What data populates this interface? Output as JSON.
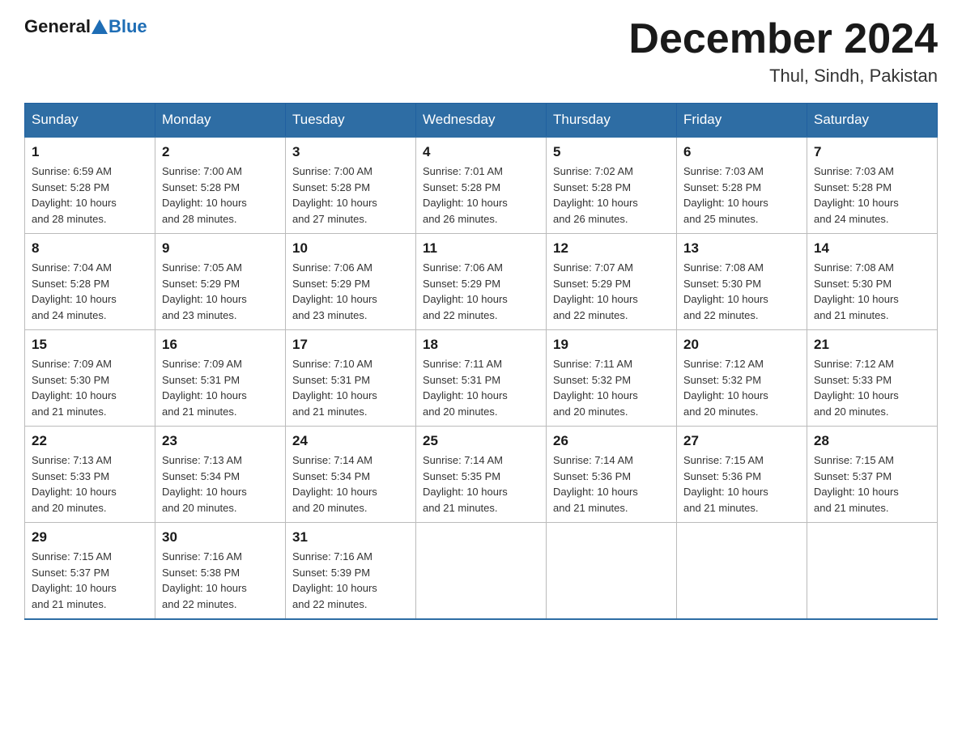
{
  "header": {
    "logo": {
      "general": "General",
      "blue": "Blue"
    },
    "title": "December 2024",
    "location": "Thul, Sindh, Pakistan"
  },
  "calendar": {
    "days_of_week": [
      "Sunday",
      "Monday",
      "Tuesday",
      "Wednesday",
      "Thursday",
      "Friday",
      "Saturday"
    ],
    "weeks": [
      [
        {
          "day": "1",
          "sunrise": "Sunrise: 6:59 AM",
          "sunset": "Sunset: 5:28 PM",
          "daylight": "Daylight: 10 hours",
          "daylight2": "and 28 minutes."
        },
        {
          "day": "2",
          "sunrise": "Sunrise: 7:00 AM",
          "sunset": "Sunset: 5:28 PM",
          "daylight": "Daylight: 10 hours",
          "daylight2": "and 28 minutes."
        },
        {
          "day": "3",
          "sunrise": "Sunrise: 7:00 AM",
          "sunset": "Sunset: 5:28 PM",
          "daylight": "Daylight: 10 hours",
          "daylight2": "and 27 minutes."
        },
        {
          "day": "4",
          "sunrise": "Sunrise: 7:01 AM",
          "sunset": "Sunset: 5:28 PM",
          "daylight": "Daylight: 10 hours",
          "daylight2": "and 26 minutes."
        },
        {
          "day": "5",
          "sunrise": "Sunrise: 7:02 AM",
          "sunset": "Sunset: 5:28 PM",
          "daylight": "Daylight: 10 hours",
          "daylight2": "and 26 minutes."
        },
        {
          "day": "6",
          "sunrise": "Sunrise: 7:03 AM",
          "sunset": "Sunset: 5:28 PM",
          "daylight": "Daylight: 10 hours",
          "daylight2": "and 25 minutes."
        },
        {
          "day": "7",
          "sunrise": "Sunrise: 7:03 AM",
          "sunset": "Sunset: 5:28 PM",
          "daylight": "Daylight: 10 hours",
          "daylight2": "and 24 minutes."
        }
      ],
      [
        {
          "day": "8",
          "sunrise": "Sunrise: 7:04 AM",
          "sunset": "Sunset: 5:28 PM",
          "daylight": "Daylight: 10 hours",
          "daylight2": "and 24 minutes."
        },
        {
          "day": "9",
          "sunrise": "Sunrise: 7:05 AM",
          "sunset": "Sunset: 5:29 PM",
          "daylight": "Daylight: 10 hours",
          "daylight2": "and 23 minutes."
        },
        {
          "day": "10",
          "sunrise": "Sunrise: 7:06 AM",
          "sunset": "Sunset: 5:29 PM",
          "daylight": "Daylight: 10 hours",
          "daylight2": "and 23 minutes."
        },
        {
          "day": "11",
          "sunrise": "Sunrise: 7:06 AM",
          "sunset": "Sunset: 5:29 PM",
          "daylight": "Daylight: 10 hours",
          "daylight2": "and 22 minutes."
        },
        {
          "day": "12",
          "sunrise": "Sunrise: 7:07 AM",
          "sunset": "Sunset: 5:29 PM",
          "daylight": "Daylight: 10 hours",
          "daylight2": "and 22 minutes."
        },
        {
          "day": "13",
          "sunrise": "Sunrise: 7:08 AM",
          "sunset": "Sunset: 5:30 PM",
          "daylight": "Daylight: 10 hours",
          "daylight2": "and 22 minutes."
        },
        {
          "day": "14",
          "sunrise": "Sunrise: 7:08 AM",
          "sunset": "Sunset: 5:30 PM",
          "daylight": "Daylight: 10 hours",
          "daylight2": "and 21 minutes."
        }
      ],
      [
        {
          "day": "15",
          "sunrise": "Sunrise: 7:09 AM",
          "sunset": "Sunset: 5:30 PM",
          "daylight": "Daylight: 10 hours",
          "daylight2": "and 21 minutes."
        },
        {
          "day": "16",
          "sunrise": "Sunrise: 7:09 AM",
          "sunset": "Sunset: 5:31 PM",
          "daylight": "Daylight: 10 hours",
          "daylight2": "and 21 minutes."
        },
        {
          "day": "17",
          "sunrise": "Sunrise: 7:10 AM",
          "sunset": "Sunset: 5:31 PM",
          "daylight": "Daylight: 10 hours",
          "daylight2": "and 21 minutes."
        },
        {
          "day": "18",
          "sunrise": "Sunrise: 7:11 AM",
          "sunset": "Sunset: 5:31 PM",
          "daylight": "Daylight: 10 hours",
          "daylight2": "and 20 minutes."
        },
        {
          "day": "19",
          "sunrise": "Sunrise: 7:11 AM",
          "sunset": "Sunset: 5:32 PM",
          "daylight": "Daylight: 10 hours",
          "daylight2": "and 20 minutes."
        },
        {
          "day": "20",
          "sunrise": "Sunrise: 7:12 AM",
          "sunset": "Sunset: 5:32 PM",
          "daylight": "Daylight: 10 hours",
          "daylight2": "and 20 minutes."
        },
        {
          "day": "21",
          "sunrise": "Sunrise: 7:12 AM",
          "sunset": "Sunset: 5:33 PM",
          "daylight": "Daylight: 10 hours",
          "daylight2": "and 20 minutes."
        }
      ],
      [
        {
          "day": "22",
          "sunrise": "Sunrise: 7:13 AM",
          "sunset": "Sunset: 5:33 PM",
          "daylight": "Daylight: 10 hours",
          "daylight2": "and 20 minutes."
        },
        {
          "day": "23",
          "sunrise": "Sunrise: 7:13 AM",
          "sunset": "Sunset: 5:34 PM",
          "daylight": "Daylight: 10 hours",
          "daylight2": "and 20 minutes."
        },
        {
          "day": "24",
          "sunrise": "Sunrise: 7:14 AM",
          "sunset": "Sunset: 5:34 PM",
          "daylight": "Daylight: 10 hours",
          "daylight2": "and 20 minutes."
        },
        {
          "day": "25",
          "sunrise": "Sunrise: 7:14 AM",
          "sunset": "Sunset: 5:35 PM",
          "daylight": "Daylight: 10 hours",
          "daylight2": "and 21 minutes."
        },
        {
          "day": "26",
          "sunrise": "Sunrise: 7:14 AM",
          "sunset": "Sunset: 5:36 PM",
          "daylight": "Daylight: 10 hours",
          "daylight2": "and 21 minutes."
        },
        {
          "day": "27",
          "sunrise": "Sunrise: 7:15 AM",
          "sunset": "Sunset: 5:36 PM",
          "daylight": "Daylight: 10 hours",
          "daylight2": "and 21 minutes."
        },
        {
          "day": "28",
          "sunrise": "Sunrise: 7:15 AM",
          "sunset": "Sunset: 5:37 PM",
          "daylight": "Daylight: 10 hours",
          "daylight2": "and 21 minutes."
        }
      ],
      [
        {
          "day": "29",
          "sunrise": "Sunrise: 7:15 AM",
          "sunset": "Sunset: 5:37 PM",
          "daylight": "Daylight: 10 hours",
          "daylight2": "and 21 minutes."
        },
        {
          "day": "30",
          "sunrise": "Sunrise: 7:16 AM",
          "sunset": "Sunset: 5:38 PM",
          "daylight": "Daylight: 10 hours",
          "daylight2": "and 22 minutes."
        },
        {
          "day": "31",
          "sunrise": "Sunrise: 7:16 AM",
          "sunset": "Sunset: 5:39 PM",
          "daylight": "Daylight: 10 hours",
          "daylight2": "and 22 minutes."
        },
        null,
        null,
        null,
        null
      ]
    ]
  }
}
